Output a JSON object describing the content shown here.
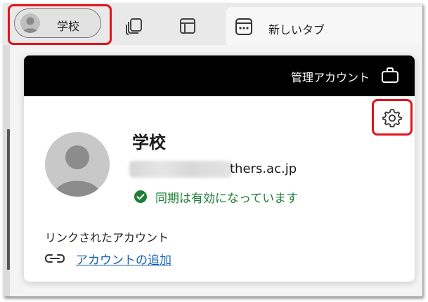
{
  "tabstrip": {
    "profile_label": "学校",
    "newtab_label": "新しいタブ",
    "icons": [
      "person-avatar-icon",
      "workspaces-icon",
      "tab-actions-icon",
      "new-tab-page-icon"
    ]
  },
  "flyout": {
    "managed_label": "管理アカウント",
    "profile_name": "学校",
    "email_visible": "thers.ac.jp",
    "sync_status": "同期は有効になっています",
    "linked_accounts_label": "リンクされたアカウント",
    "add_account_label": "アカウントの追加"
  },
  "colors": {
    "highlight": "#e2141a",
    "header_bg": "#000000",
    "sync_green": "#1d7f35",
    "link_blue": "#1360b6",
    "tabstrip_bg": "#e9e9e9"
  }
}
